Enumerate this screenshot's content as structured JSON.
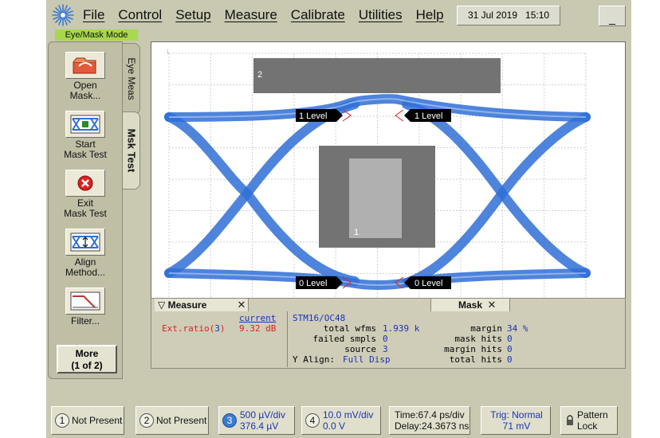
{
  "menu": {
    "items": [
      "File",
      "Control",
      "Setup",
      "Measure",
      "Calibrate",
      "Utilities",
      "Help"
    ]
  },
  "datetime": {
    "date": "31 Jul 2019",
    "time": "15:10"
  },
  "minimize_label": "_",
  "mode_label": "Eye/Mask Mode",
  "tools": [
    {
      "label1": "Open",
      "label2": "Mask..."
    },
    {
      "label1": "Start",
      "label2": "Mask Test"
    },
    {
      "label1": "Exit",
      "label2": "Mask Test"
    },
    {
      "label1": "Align",
      "label2": "Method..."
    },
    {
      "label1": "Filter...",
      "label2": ""
    }
  ],
  "more": {
    "line1": "More",
    "line2": "(1 of 2)"
  },
  "tabs": {
    "eye_meas": "Eye Meas",
    "msk_test": "Msk Test"
  },
  "screen": {
    "region_top": "2",
    "region_center": "1",
    "level_labels": {
      "top_left": "1 Level",
      "top_right": "1 Level",
      "bottom_left": "0 Level",
      "bottom_right": "0 Level"
    },
    "colors": {
      "waveform": "#2f6fd6",
      "mask_region": "#737373",
      "inner_region": "#b0b0b0"
    }
  },
  "measure": {
    "title": "Measure",
    "column_header": "current",
    "name": "Ext.ratio(",
    "channel": "3",
    "name_end": ")",
    "value": "9.32 dB"
  },
  "mask": {
    "title": "Mask",
    "standard": "STM16/OC48",
    "rows": [
      {
        "label": "total wfms",
        "value": "1.939 k",
        "label2": "margin",
        "value2": "34 %"
      },
      {
        "label": "failed smpls",
        "value": "0",
        "label2": "mask hits",
        "value2": "0"
      },
      {
        "label": "source",
        "value": "3",
        "label2": "margin hits",
        "value2": "0"
      },
      {
        "label": "Y Align:",
        "value": "Full Disp",
        "label2": "total hits",
        "value2": "0"
      }
    ]
  },
  "bottom": {
    "ch1": {
      "num": "1",
      "label": "Not Present"
    },
    "ch2": {
      "num": "2",
      "label": "Not Present"
    },
    "ch3": {
      "num": "3",
      "line1": "500 µV/div",
      "line2": "376.4 µV"
    },
    "ch4": {
      "num": "4",
      "line1": "10.0 mV/div",
      "line2": "0.0 V"
    },
    "time": {
      "line1": "Time:67.4 ps/div",
      "line2": "Delay:24.3673 ns"
    },
    "trig": {
      "line1": "Trig: Normal",
      "line2": "71 mV"
    },
    "pattern": {
      "line1": "Pattern",
      "line2": "Lock"
    }
  }
}
